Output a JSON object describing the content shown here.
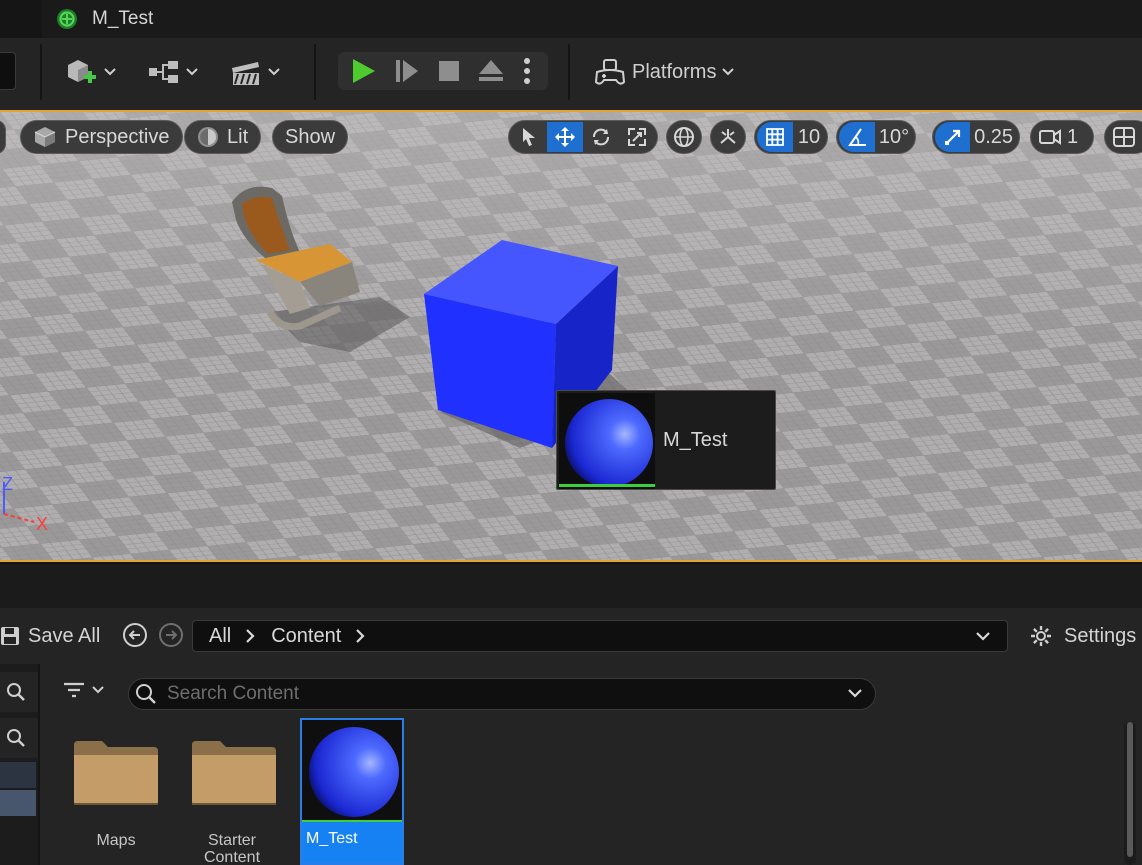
{
  "tab": {
    "title": "M_Test",
    "logo_icon": "unreal-logo-icon"
  },
  "toolbar": {
    "icons": [
      "add-actor-icon",
      "blueprint-icon",
      "cinematics-icon"
    ],
    "play_controls": [
      "play-icon",
      "advance-frame-icon",
      "stop-icon",
      "eject-icon",
      "more-options-icon"
    ],
    "platforms_label": "Platforms"
  },
  "viewport": {
    "perspective_label": "Perspective",
    "lit_label": "Lit",
    "show_label": "Show",
    "grid_snap_value": "10",
    "rotation_snap_value": "10°",
    "scale_snap_value": "0.25",
    "camera_speed_value": "1",
    "tooltip_label": "M_Test",
    "axis_z": "Z",
    "axis_x": "X",
    "accent_color": "#1e6fd0",
    "selection_border_color": "#e0a437"
  },
  "content_browser": {
    "save_all_label": "Save All",
    "breadcrumbs": [
      "All",
      "Content"
    ],
    "settings_label": "Settings",
    "search_placeholder": "Search Content",
    "assets": [
      {
        "name": "Maps",
        "type": "folder"
      },
      {
        "name": "Starter Content",
        "type": "folder"
      },
      {
        "name": "M_Test",
        "type": "material",
        "selected": true
      }
    ]
  }
}
